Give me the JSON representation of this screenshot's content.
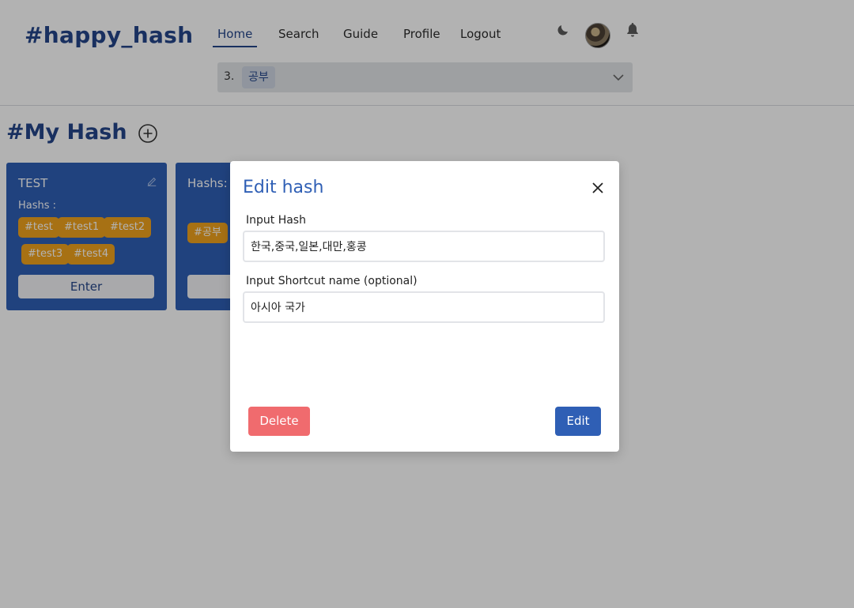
{
  "app": {
    "logo": "#happy_hash"
  },
  "nav": {
    "items": [
      {
        "label": "Home",
        "active": true
      },
      {
        "label": "Search"
      },
      {
        "label": "Guide"
      },
      {
        "label": "Profile"
      },
      {
        "label": "Logout"
      }
    ]
  },
  "header_icons": {
    "theme": "moon-icon",
    "avatar": "avatar",
    "notifications": "bell-icon"
  },
  "hash_select": {
    "index": "3.",
    "value": "공부",
    "icon": "chevron-down-icon"
  },
  "section": {
    "title": "#My Hash",
    "add_icon": "plus-circle-icon"
  },
  "cards": [
    {
      "title": "TEST",
      "hashes_label": "Hashs :",
      "hashes": [
        "#test",
        "#test1",
        "#test2",
        "#test3",
        "#test4"
      ],
      "enter_label": "Enter"
    },
    {
      "title": "Hashs:",
      "hashes": [
        "#공부"
      ]
    }
  ],
  "modal": {
    "title": "Edit hash",
    "close_icon": "close-icon",
    "hash_label": "Input Hash",
    "hash_value": "한국,중국,일본,대만,홍콩",
    "shortcut_label": "Input Shortcut name (optional)",
    "shortcut_value": "아시아 국가",
    "delete_label": "Delete",
    "edit_label": "Edit"
  },
  "colors": {
    "brand": "#24468a",
    "card": "#2f5fb5",
    "chip": "#f0a21e",
    "danger": "#f06b6e",
    "overlay": "rgba(0,0,0,0.3)"
  }
}
